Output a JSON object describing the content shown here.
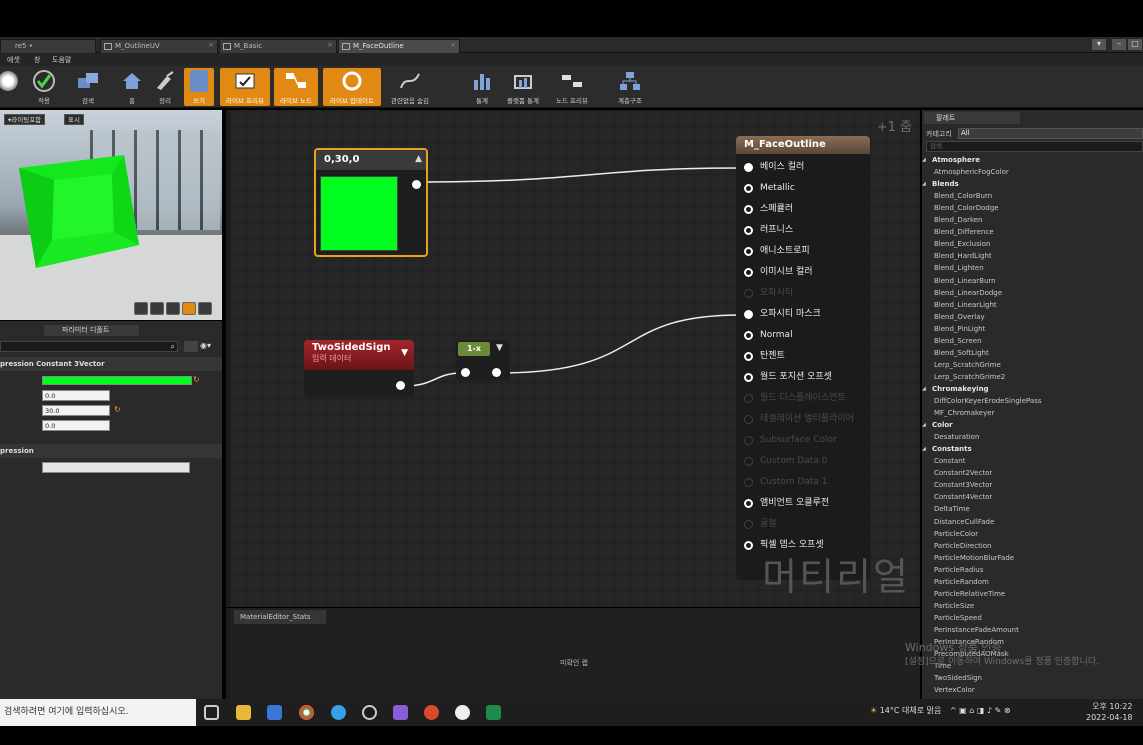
{
  "tabs": [
    {
      "label": "re5 •",
      "active": false
    },
    {
      "label": "M_OutlineUV",
      "active": false
    },
    {
      "label": "M_Basic",
      "active": false
    },
    {
      "label": "M_FaceOutline",
      "active": true
    }
  ],
  "menu": [
    "애셋",
    "창",
    "도움말"
  ],
  "toolbar": [
    {
      "label": "적용",
      "on": false
    },
    {
      "label": "검색",
      "on": false
    },
    {
      "label": "홈",
      "on": false
    },
    {
      "label": "정리",
      "on": false
    },
    {
      "label": "쓰기",
      "on": true
    },
    {
      "label": "라이브 프리뷰",
      "on": true
    },
    {
      "label": "라이브 노드",
      "on": true
    },
    {
      "label": "라이브 업데이트",
      "on": true
    },
    {
      "label": "관련없음 숨김",
      "on": false
    },
    {
      "label": "통계",
      "on": false
    },
    {
      "label": "플랫폼 통계",
      "on": false
    },
    {
      "label": "노드 프리뷰",
      "on": false
    },
    {
      "label": "계층구조",
      "on": false
    }
  ],
  "viewport": {
    "lit_label": "라이팅포함",
    "show_label": "표시"
  },
  "details": {
    "tab_label": "파라미터 디폴트",
    "section1": "pression Constant 3Vector",
    "constant_color": "#00ff1e",
    "values": [
      "0.0",
      "30.0",
      "0.0"
    ],
    "section2": "pression"
  },
  "graph": {
    "zoom": "+1 줌",
    "watermark": "머티리얼",
    "constant_node": {
      "title": "0,30,0",
      "color": "#00ff1e"
    },
    "tss_node": {
      "title": "TwoSidedSign",
      "subtitle": "입력 데이터"
    },
    "oneminus_node": {
      "title": "1-x"
    },
    "material_node": {
      "title": "M_FaceOutline",
      "pins": [
        {
          "label": "베이스 컬러",
          "state": "on"
        },
        {
          "label": "Metallic",
          "state": "ring"
        },
        {
          "label": "스페큘러",
          "state": "ring"
        },
        {
          "label": "러프니스",
          "state": "ring"
        },
        {
          "label": "애니소트로피",
          "state": "ring"
        },
        {
          "label": "이미시브 컬러",
          "state": "ring"
        },
        {
          "label": "오파시티",
          "state": "dim"
        },
        {
          "label": "오파시티 마스크",
          "state": "on"
        },
        {
          "label": "Normal",
          "state": "ring"
        },
        {
          "label": "탄젠트",
          "state": "ring"
        },
        {
          "label": "월드 포지션 오프셋",
          "state": "ring"
        },
        {
          "label": "월드 디스플레이스먼트",
          "state": "dim"
        },
        {
          "label": "테셀레이션 멀티플라이어",
          "state": "dim"
        },
        {
          "label": "Subsurface Color",
          "state": "dim"
        },
        {
          "label": "Custom Data 0",
          "state": "dim"
        },
        {
          "label": "Custom Data 1",
          "state": "dim"
        },
        {
          "label": "앰비언트 오클루전",
          "state": "ring"
        },
        {
          "label": "굴절",
          "state": "dim"
        },
        {
          "label": "픽셀 뎁스 오프셋",
          "state": "ring"
        }
      ]
    }
  },
  "stats": {
    "tab_label": "MaterialEditor_Stats",
    "message": "미확인 랩"
  },
  "palette": {
    "tab_label": "팔레트",
    "category_label": "카테고리",
    "category_value": "All",
    "search_placeholder": "검색",
    "items": [
      {
        "type": "cat",
        "label": "Atmosphere"
      },
      {
        "type": "leaf",
        "label": "AtmosphericFogColor"
      },
      {
        "type": "cat",
        "label": "Blends"
      },
      {
        "type": "leaf",
        "label": "Blend_ColorBurn"
      },
      {
        "type": "leaf",
        "label": "Blend_ColorDodge"
      },
      {
        "type": "leaf",
        "label": "Blend_Darken"
      },
      {
        "type": "leaf",
        "label": "Blend_Difference"
      },
      {
        "type": "leaf",
        "label": "Blend_Exclusion"
      },
      {
        "type": "leaf",
        "label": "Blend_HardLight"
      },
      {
        "type": "leaf",
        "label": "Blend_Lighten"
      },
      {
        "type": "leaf",
        "label": "Blend_LinearBurn"
      },
      {
        "type": "leaf",
        "label": "Blend_LinearDodge"
      },
      {
        "type": "leaf",
        "label": "Blend_LinearLight"
      },
      {
        "type": "leaf",
        "label": "Blend_Overlay"
      },
      {
        "type": "leaf",
        "label": "Blend_PinLight"
      },
      {
        "type": "leaf",
        "label": "Blend_Screen"
      },
      {
        "type": "leaf",
        "label": "Blend_SoftLight"
      },
      {
        "type": "leaf",
        "label": "Lerp_ScratchGrime"
      },
      {
        "type": "leaf",
        "label": "Lerp_ScratchGrime2"
      },
      {
        "type": "cat",
        "label": "Chromakeying"
      },
      {
        "type": "leaf",
        "label": "DiffColorKeyerErodeSinglePass"
      },
      {
        "type": "leaf",
        "label": "MF_Chromakeyer"
      },
      {
        "type": "cat",
        "label": "Color"
      },
      {
        "type": "leaf",
        "label": "Desaturation"
      },
      {
        "type": "cat",
        "label": "Constants"
      },
      {
        "type": "leaf",
        "label": "Constant"
      },
      {
        "type": "leaf",
        "label": "Constant2Vector"
      },
      {
        "type": "leaf",
        "label": "Constant3Vector"
      },
      {
        "type": "leaf",
        "label": "Constant4Vector"
      },
      {
        "type": "leaf",
        "label": "DeltaTime"
      },
      {
        "type": "leaf",
        "label": "DistanceCullFade"
      },
      {
        "type": "leaf",
        "label": "ParticleColor"
      },
      {
        "type": "leaf",
        "label": "ParticleDirection"
      },
      {
        "type": "leaf",
        "label": "ParticleMotionBlurFade"
      },
      {
        "type": "leaf",
        "label": "ParticleRadius"
      },
      {
        "type": "leaf",
        "label": "ParticleRandom"
      },
      {
        "type": "leaf",
        "label": "ParticleRelativeTime"
      },
      {
        "type": "leaf",
        "label": "ParticleSize"
      },
      {
        "type": "leaf",
        "label": "ParticleSpeed"
      },
      {
        "type": "leaf",
        "label": "PerInstanceFadeAmount"
      },
      {
        "type": "leaf",
        "label": "PerInstanceRandom"
      },
      {
        "type": "leaf",
        "label": "PrecomputedAOMask"
      },
      {
        "type": "leaf",
        "label": "Time"
      },
      {
        "type": "leaf",
        "label": "TwoSidedSign"
      },
      {
        "type": "leaf",
        "label": "VertexColor"
      }
    ]
  },
  "activation": {
    "line1": "Windows 정품 인증",
    "line2": "[설정]으로 이동하여 Windows를 정품 인증합니다."
  },
  "taskbar": {
    "search_placeholder": "검색하려면 여기에 입력하십시오.",
    "weather": "14°C  대체로 맑음",
    "time": "오후 10:22",
    "date": "2022-04-18"
  },
  "colors": {
    "accent": "#e08a14",
    "node_selected": "#e8a020",
    "tss_header": "#a4262c",
    "oneminus_header": "#6b8a3a",
    "material_header": "#8a6e56"
  },
  "icons": [
    "gear-icon",
    "check-icon",
    "search-icon",
    "home-icon",
    "broom-icon",
    "save-icon",
    "stats-icon",
    "hierarchy-icon",
    "search-icon",
    "windows-icon"
  ]
}
